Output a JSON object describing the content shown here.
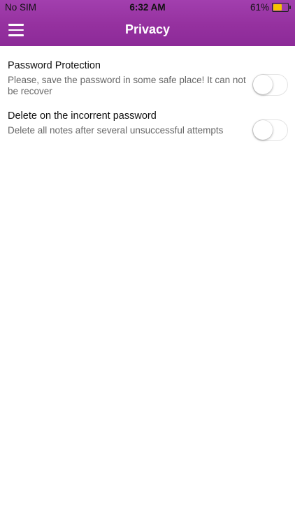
{
  "status_bar": {
    "carrier": "No SIM",
    "time": "6:32 AM",
    "battery_percent": "61%",
    "battery_level": 0.61,
    "battery_color": "#f5c400"
  },
  "header": {
    "title": "Privacy",
    "menu_icon": "hamburger-menu-icon",
    "background_color": "#9b37a6"
  },
  "settings": [
    {
      "title": "Password Protection",
      "description_line1": "Please, save the password in some safe place! It can not",
      "description_line2": "be recover",
      "enabled": false
    },
    {
      "title": "Delete on the incorrent password",
      "description_line1": "Delete all notes after several unsuccessful attempts",
      "enabled": false
    }
  ]
}
